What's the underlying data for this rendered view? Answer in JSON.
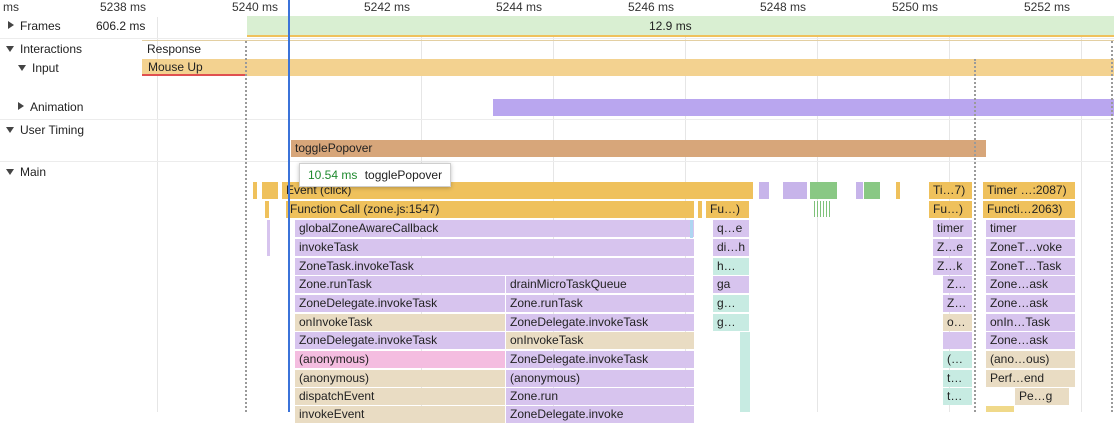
{
  "ruler": {
    "ticks": [
      "ms",
      "5238 ms",
      "5240 ms",
      "5242 ms",
      "5244 ms",
      "5246 ms",
      "5248 ms",
      "5250 ms",
      "5252 ms"
    ]
  },
  "tracks": {
    "frames": {
      "label": "Frames",
      "value": "606.2 ms",
      "frame_duration": "12.9 ms"
    },
    "interactions": {
      "label": "Interactions",
      "response": "Response"
    },
    "input": {
      "label": "Input",
      "event": "Mouse Up"
    },
    "animation": {
      "label": "Animation"
    },
    "user_timing": {
      "label": "User Timing",
      "measure": "togglePopover"
    },
    "main": {
      "label": "Main"
    }
  },
  "tooltip": {
    "duration": "10.54 ms",
    "name": "togglePopover"
  },
  "flame": {
    "event_click": "Event (click)",
    "timer_1": "Ti…7)",
    "timer_2": "Timer …:2087)",
    "function_call": "Function Call (zone.js:1547)",
    "fu_1": "Fu…)",
    "fu_2": "Fu…)",
    "functi_2063": "Functi…2063)",
    "col1": [
      "globalZoneAwareCallback",
      "invokeTask",
      "ZoneTask.invokeTask",
      "Zone.runTask",
      "ZoneDelegate.invokeTask",
      "onInvokeTask",
      "ZoneDelegate.invokeTask",
      "(anonymous)",
      "(anonymous)",
      "dispatchEvent",
      "invokeEvent"
    ],
    "col2": [
      "drainMicroTaskQueue",
      "Zone.runTask",
      "ZoneDelegate.invokeTask",
      "onInvokeTask",
      "ZoneDelegate.invokeTask",
      "(anonymous)",
      "Zone.run",
      "ZoneDelegate.invoke"
    ],
    "col3": [
      "q…e",
      "di…h",
      "h…",
      "ga",
      "g…",
      "g…"
    ],
    "col4": [
      "timer",
      "Z…e",
      "Z…k",
      "Z…",
      "Z…",
      "o…",
      "",
      "(…",
      "t…",
      "t…"
    ],
    "col5": [
      "timer",
      "ZoneT…voke",
      "ZoneT…Task",
      "Zone…ask",
      "Zone…ask",
      "onIn…Task",
      "Zone…ask",
      "(ano…ous)",
      "Perf…end",
      "Pe…g"
    ]
  },
  "colors": {
    "purple": "#d7c4ee",
    "beige": "#e9dcc3",
    "pink": "#f4bde0",
    "orange": "#efc15c",
    "frames_green": "#d9efd2",
    "animation": "#b9a6ef",
    "user_timing": "#d7a67a",
    "cursor": "#3b73d9"
  }
}
